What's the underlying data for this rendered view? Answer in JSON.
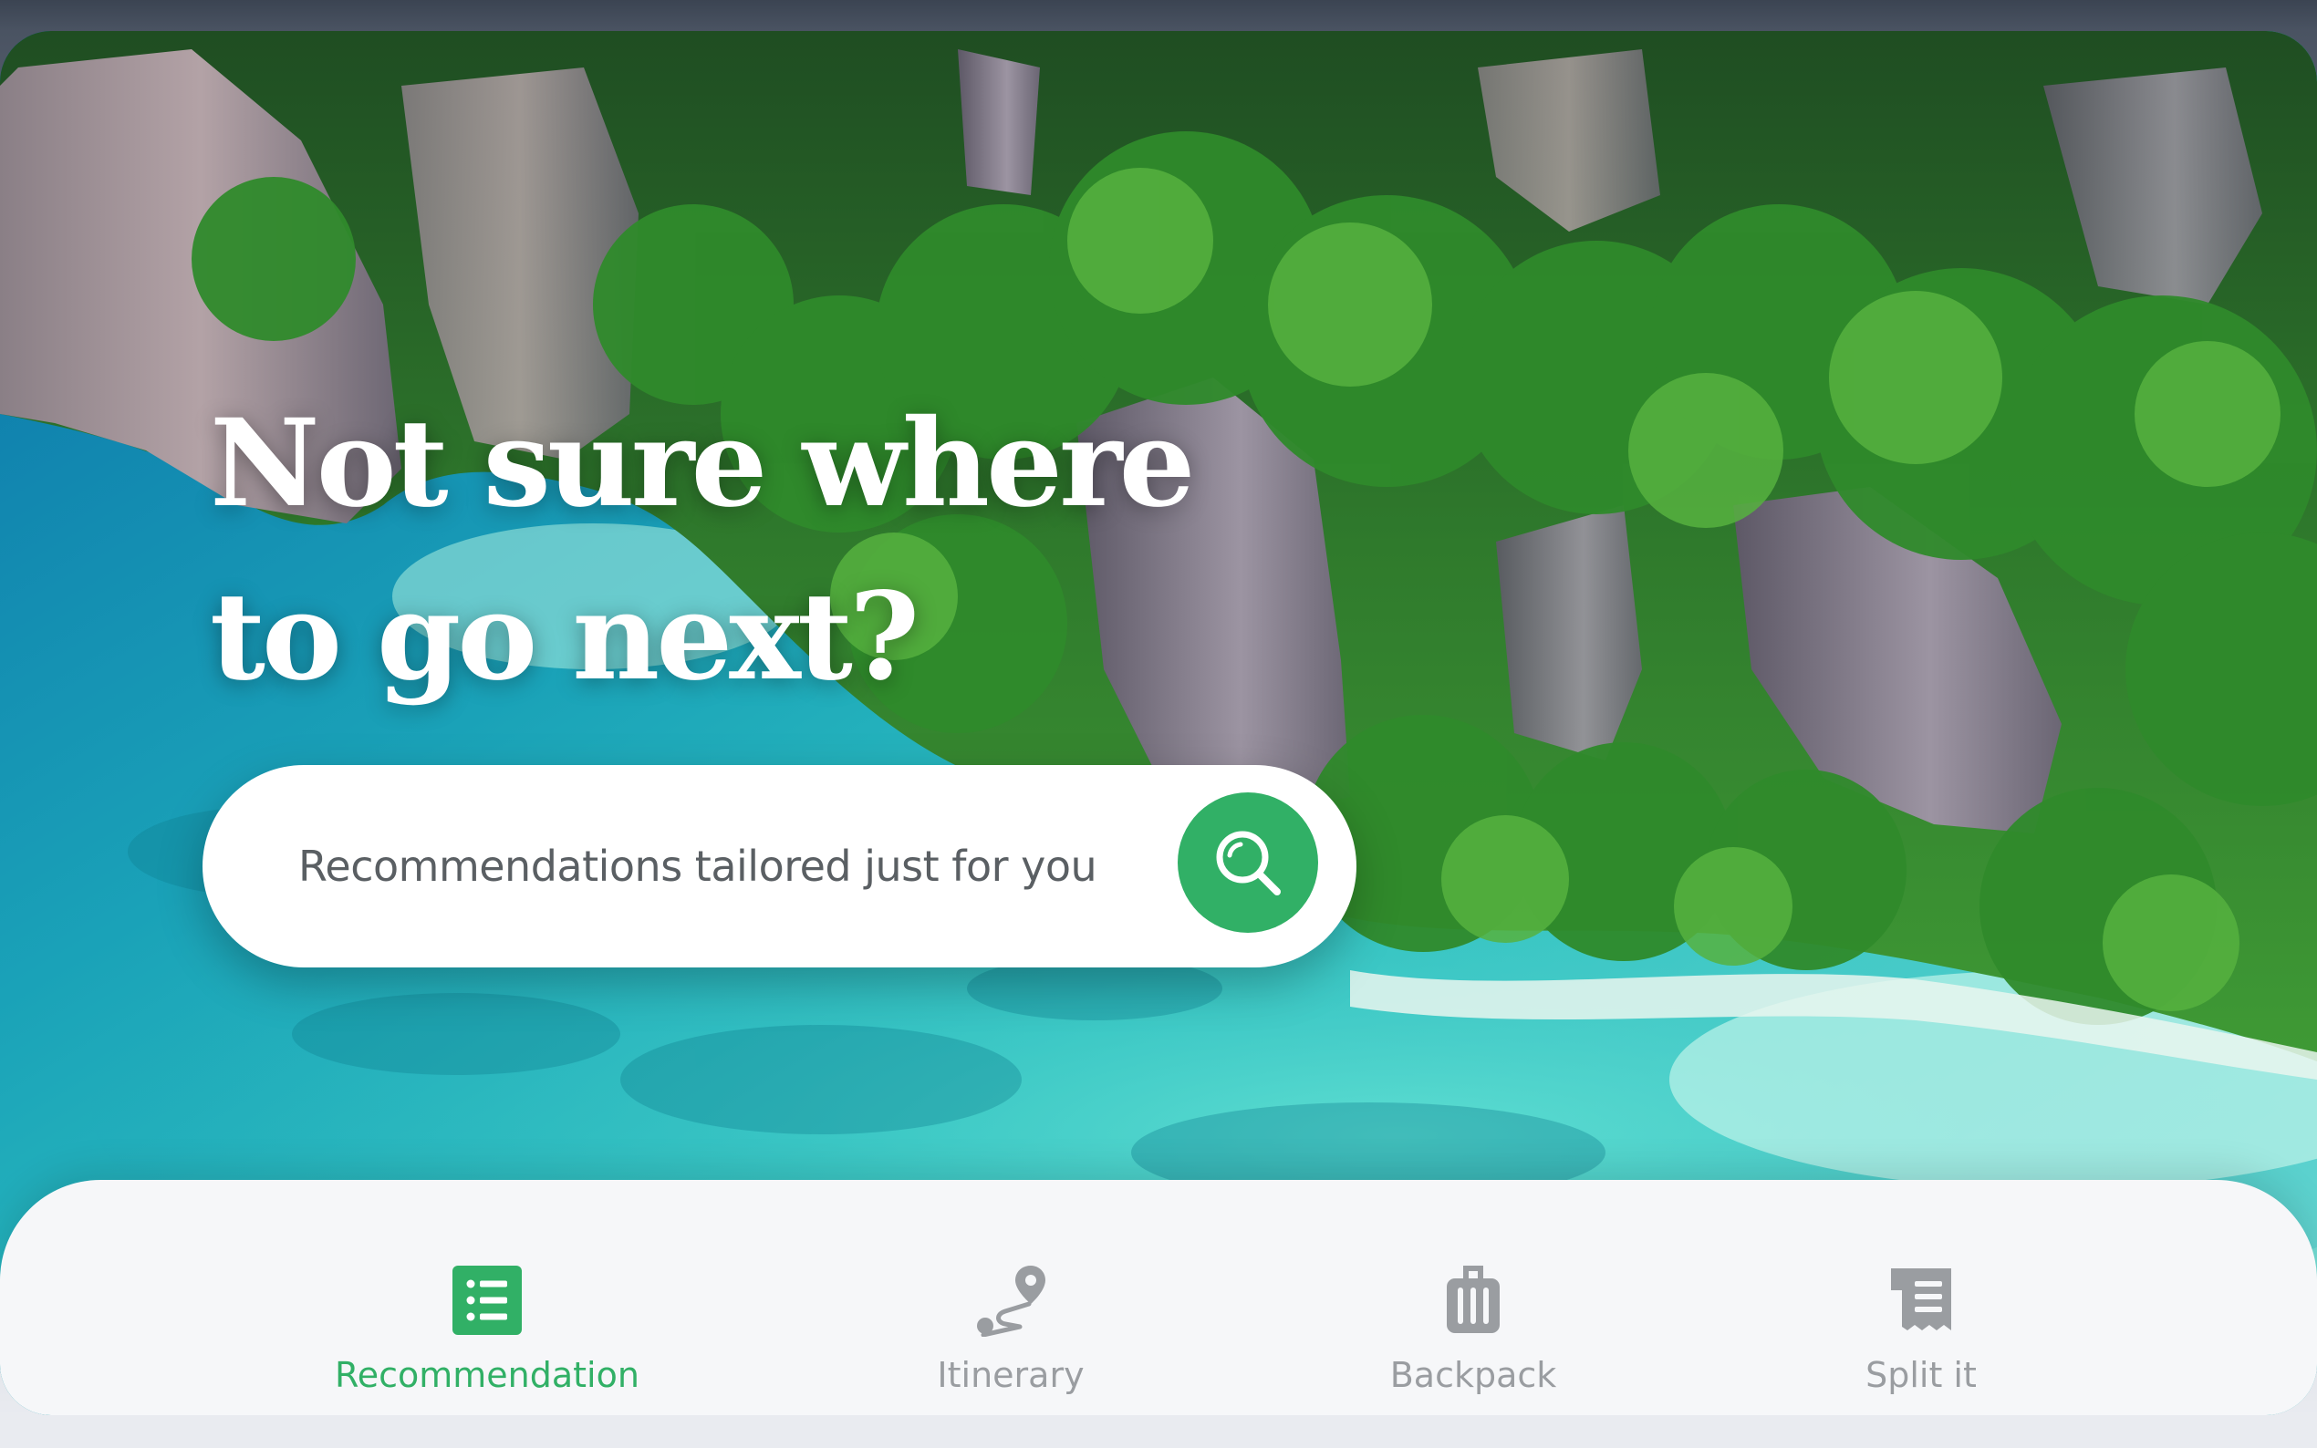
{
  "hero": {
    "headline_line1": "Not sure where",
    "headline_line2": "to go next?"
  },
  "search": {
    "placeholder": "Recommendations tailored just for you",
    "button_icon": "search-icon"
  },
  "tabbar": {
    "active": "Recommendation",
    "tabs": [
      {
        "label": "Recommendation",
        "icon": "list-icon"
      },
      {
        "label": "Itinerary",
        "icon": "route-pin-icon"
      },
      {
        "label": "Backpack",
        "icon": "luggage-icon"
      },
      {
        "label": "Split it",
        "icon": "receipt-icon"
      }
    ]
  },
  "colors": {
    "accent": "#31b066",
    "inactive": "#9a9da1",
    "tabbar_bg": "#f6f7f9"
  }
}
